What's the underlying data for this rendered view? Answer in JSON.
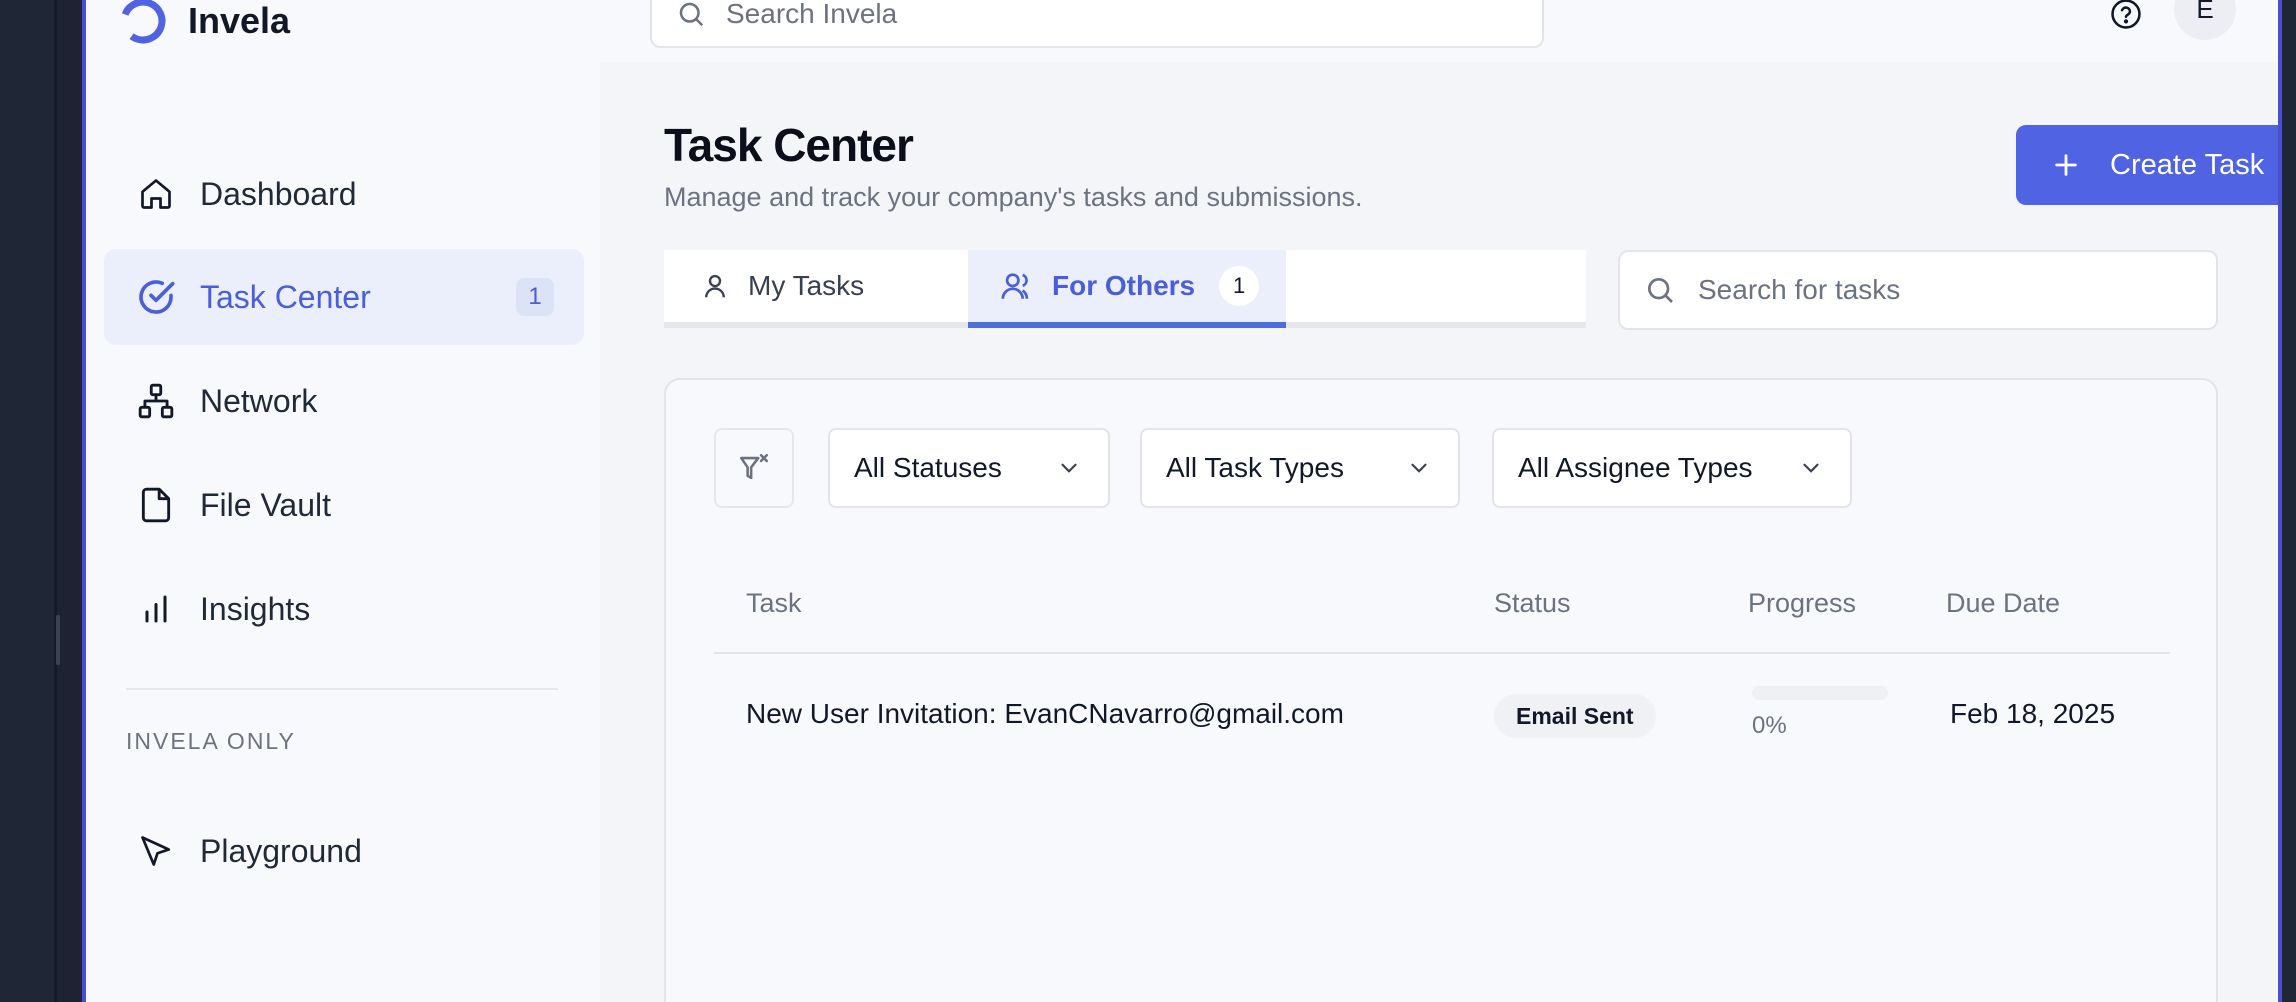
{
  "app": {
    "name": "Invela"
  },
  "colors": {
    "accent": "#4f63e3",
    "active_text": "#4a5fd7",
    "active_bg": "#ebeffb",
    "frame_border": "#4a4fd0"
  },
  "sidebar": {
    "items": [
      {
        "label": "Dashboard",
        "icon": "home-icon"
      },
      {
        "label": "Task Center",
        "icon": "check-circle-icon",
        "badge": "1",
        "active": true
      },
      {
        "label": "Network",
        "icon": "network-icon"
      },
      {
        "label": "File Vault",
        "icon": "file-icon"
      },
      {
        "label": "Insights",
        "icon": "bar-chart-icon"
      }
    ],
    "section_label": "INVELA ONLY",
    "section_items": [
      {
        "label": "Playground",
        "icon": "cursor-pointer-icon"
      }
    ]
  },
  "topbar": {
    "search_placeholder": "Search Invela",
    "help_icon": "help-circle-icon",
    "notification_icon": "bell-icon",
    "avatar_initial": "E"
  },
  "page": {
    "title": "Task Center",
    "subtitle": "Manage and track your company's tasks and submissions.",
    "create_button": "Create Task"
  },
  "tabs": [
    {
      "label": "My Tasks",
      "icon": "user-icon",
      "active": false
    },
    {
      "label": "For Others",
      "icon": "users-icon",
      "count": "1",
      "active": true
    }
  ],
  "task_search_placeholder": "Search for tasks",
  "filters": {
    "clear_icon": "filter-x-icon",
    "status": "All Statuses",
    "task_type": "All Task Types",
    "assignee_type": "All Assignee Types"
  },
  "table": {
    "columns": [
      "Task",
      "Status",
      "Progress",
      "Due Date"
    ],
    "rows": [
      {
        "task": "New User Invitation: EvanCNavarro@gmail.com",
        "status": "Email Sent",
        "progress": 0,
        "progress_label": "0%",
        "due_date": "Feb 18, 2025"
      }
    ]
  }
}
